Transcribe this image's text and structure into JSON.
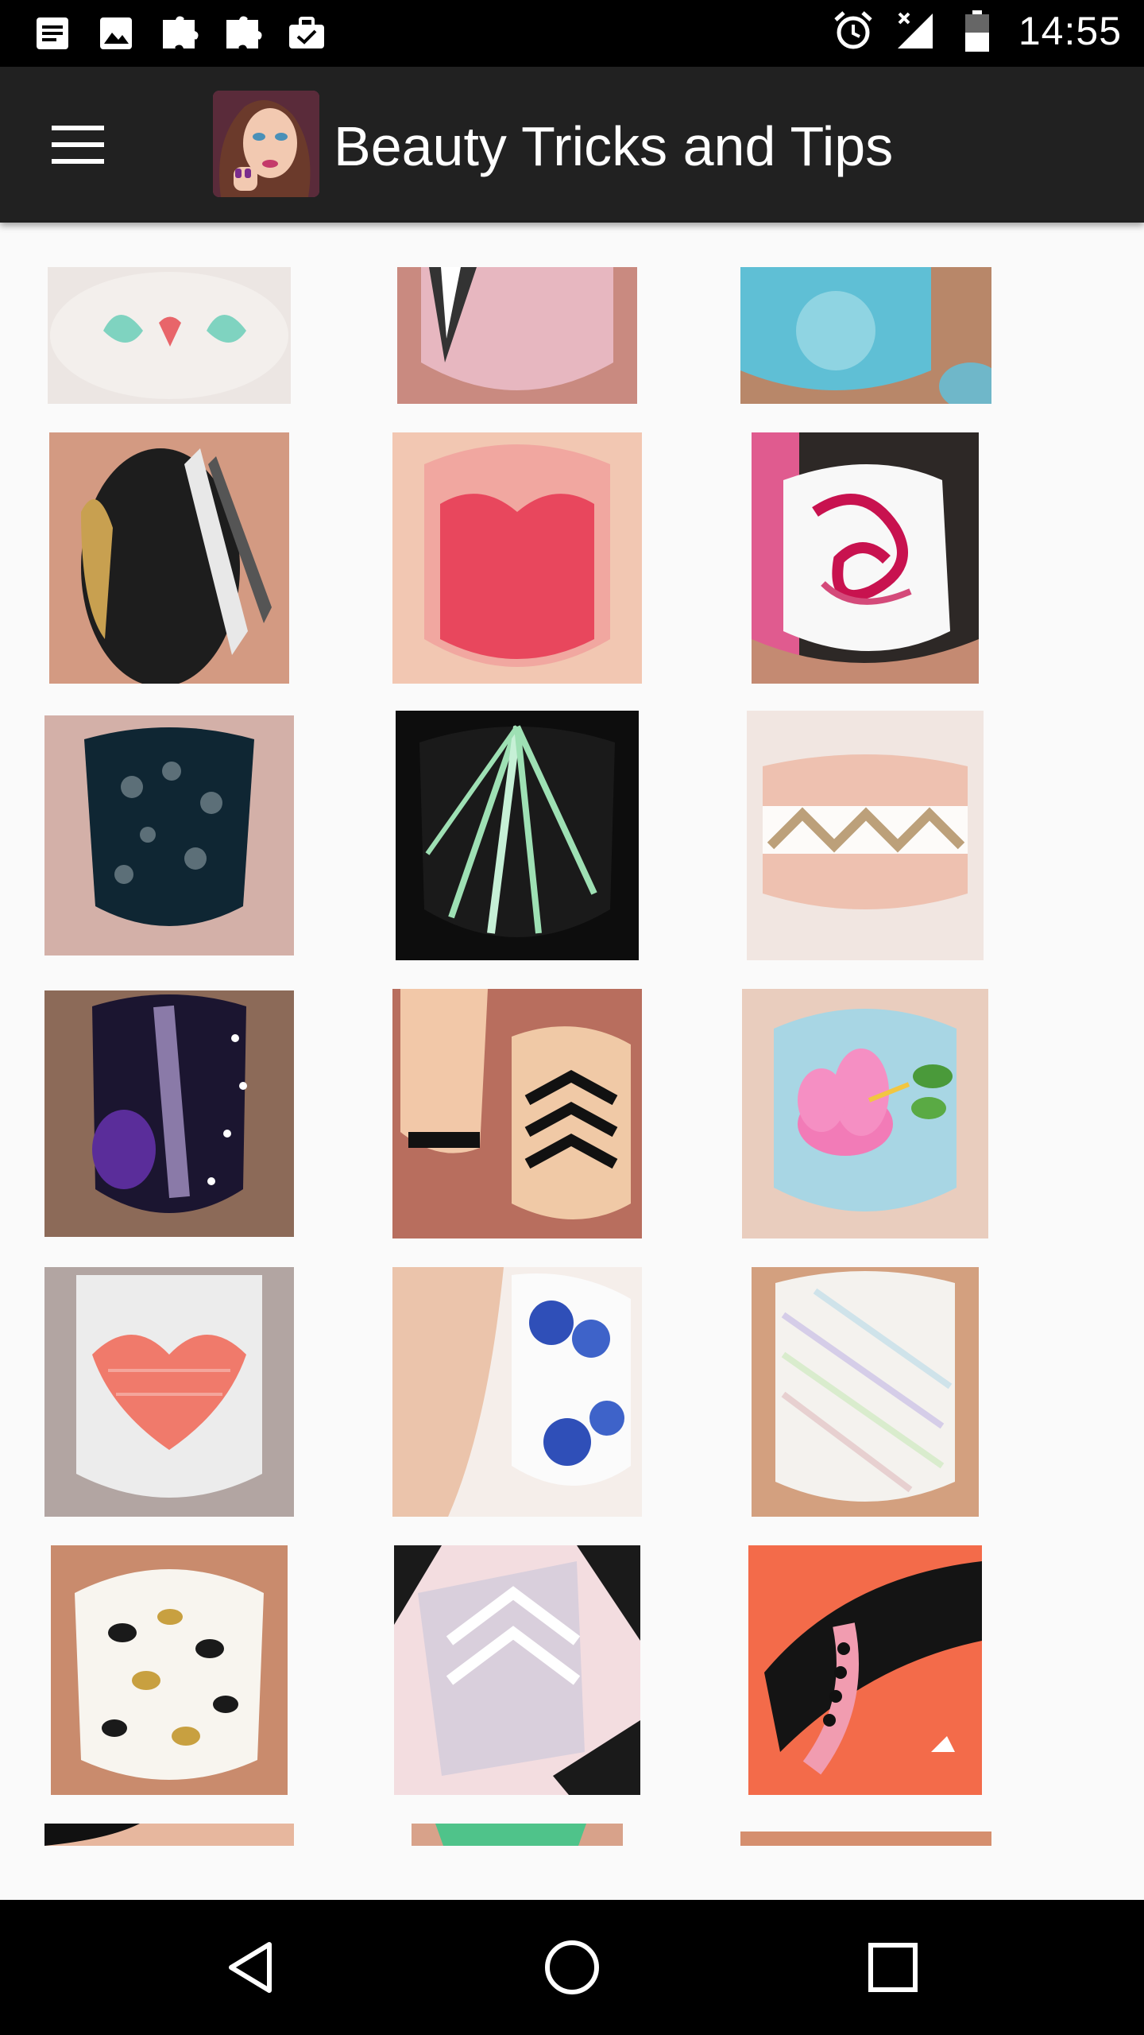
{
  "status_bar": {
    "time": "14:55",
    "left_icons": [
      "notes-icon",
      "image-icon",
      "puzzle-icon",
      "puzzle-icon",
      "briefcase-check-icon"
    ],
    "right_icons": [
      "alarm-icon",
      "signal-off-icon",
      "battery-icon"
    ]
  },
  "app_bar": {
    "title": "Beauty Tricks and Tips",
    "menu_icon": "hamburger-menu-icon",
    "logo": "app-logo"
  },
  "gallery": {
    "items": [
      {
        "alt": "nail-art-thumbnail"
      },
      {
        "alt": "nail-art-thumbnail"
      },
      {
        "alt": "nail-art-thumbnail"
      },
      {
        "alt": "nail-art-thumbnail"
      },
      {
        "alt": "nail-art-thumbnail"
      },
      {
        "alt": "nail-art-thumbnail"
      },
      {
        "alt": "nail-art-thumbnail"
      },
      {
        "alt": "nail-art-thumbnail"
      },
      {
        "alt": "nail-art-thumbnail"
      },
      {
        "alt": "nail-art-thumbnail"
      },
      {
        "alt": "nail-art-thumbnail"
      },
      {
        "alt": "nail-art-thumbnail"
      },
      {
        "alt": "nail-art-thumbnail"
      },
      {
        "alt": "nail-art-thumbnail"
      },
      {
        "alt": "nail-art-thumbnail"
      },
      {
        "alt": "nail-art-thumbnail"
      },
      {
        "alt": "nail-art-thumbnail"
      },
      {
        "alt": "nail-art-thumbnail"
      },
      {
        "alt": "nail-art-thumbnail"
      },
      {
        "alt": "nail-art-thumbnail"
      },
      {
        "alt": "nail-art-thumbnail"
      }
    ]
  },
  "nav_bar": {
    "back": "back-triangle-icon",
    "home": "home-circle-icon",
    "recents": "recents-square-icon"
  },
  "colors": {
    "status_bar": "#000000",
    "app_bar": "#212121",
    "background": "#fafafa",
    "nav_bar": "#000000"
  }
}
